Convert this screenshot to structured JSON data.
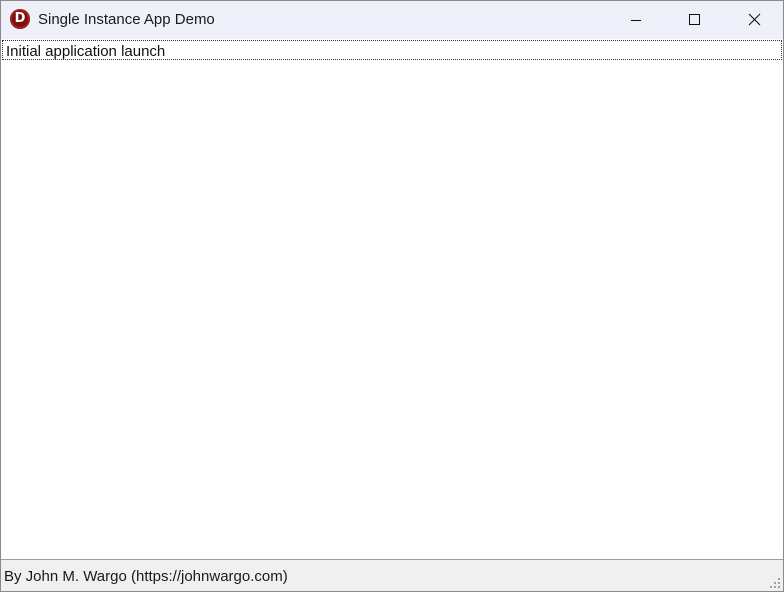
{
  "window": {
    "title": "Single Instance App Demo",
    "icon": "app-d-logo-icon",
    "icon_letter": "D",
    "icon_color": "#7a1010"
  },
  "caption_buttons": {
    "minimize_icon": "minimize-icon",
    "maximize_icon": "maximize-icon",
    "close_icon": "close-icon"
  },
  "list": {
    "items": [
      {
        "label": "Initial application launch"
      }
    ]
  },
  "statusbar": {
    "text": "By John M. Wargo (https://johnwargo.com)",
    "grip_icon": "resize-grip-icon"
  }
}
